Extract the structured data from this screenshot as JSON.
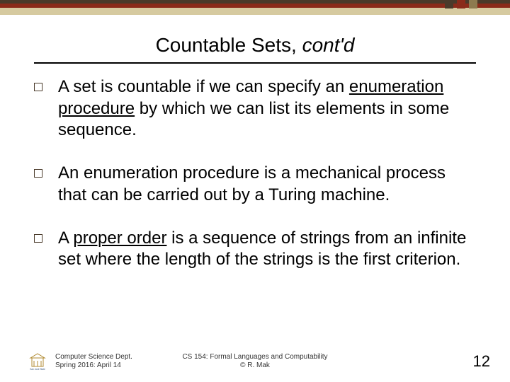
{
  "title": {
    "main": "Countable Sets, ",
    "italic": "cont'd"
  },
  "bullets": [
    {
      "pre": "A set is countable if we can specify an ",
      "u": "enumeration procedure",
      "post": " by which we can list its elements in some sequence."
    },
    {
      "pre": "An enumeration procedure is a mechanical process that can be carried out by a Turing machine.",
      "u": "",
      "post": ""
    },
    {
      "pre": "A ",
      "u": "proper order",
      "post": " is a sequence of strings from an infinite set where the length of the strings is the first criterion."
    }
  ],
  "footer": {
    "left1": "Computer Science Dept.",
    "left2": "Spring 2016: April 14",
    "center1": "CS 154: Formal Languages and Computability",
    "center2": "© R. Mak",
    "logo_caption": "San José State"
  },
  "page": "12"
}
